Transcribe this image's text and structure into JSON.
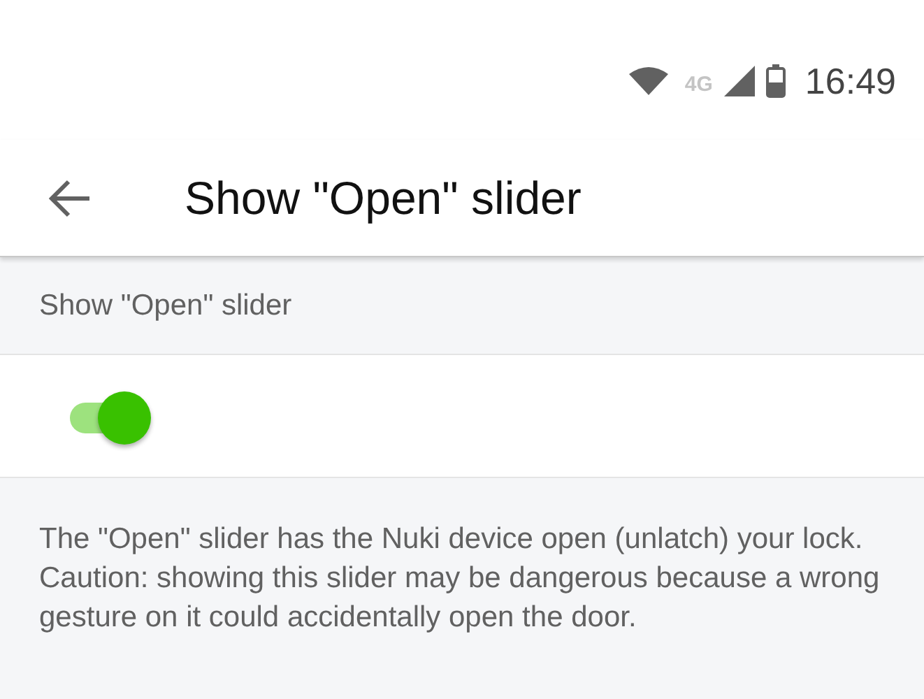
{
  "status_bar": {
    "network": "4G",
    "time": "16:49"
  },
  "app_bar": {
    "title": "Show \"Open\" slider"
  },
  "section": {
    "header": "Show \"Open\" slider",
    "toggle": {
      "on": true
    }
  },
  "description": "The \"Open\" slider has the Nuki device open (unlatch) your lock. Caution: showing this slider may be dangerous because a wrong gesture on it could accidentally open the door."
}
